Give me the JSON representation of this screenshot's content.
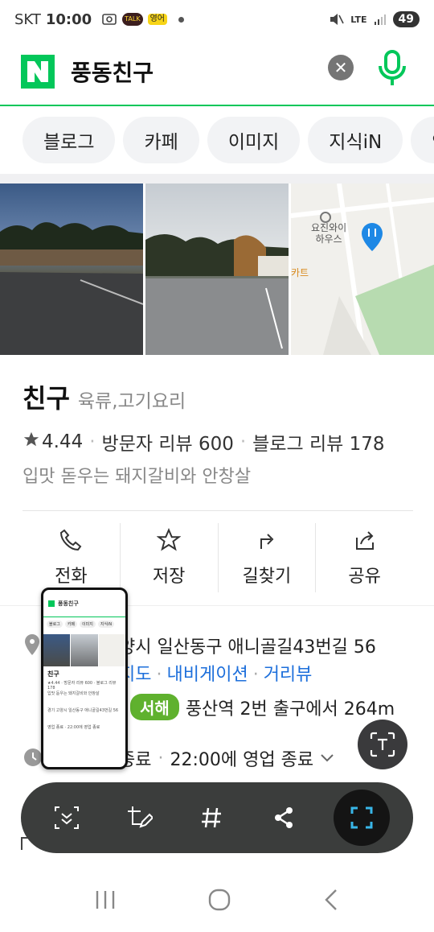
{
  "status_bar": {
    "carrier": "SKT",
    "time": "10:00",
    "talk_badge": "TALK",
    "yeongeo_badge": "영어",
    "lte": "LTE",
    "battery": "49"
  },
  "search": {
    "query": "풍동친구"
  },
  "tabs": [
    "블로그",
    "카페",
    "이미지",
    "지식iN",
    "인"
  ],
  "place": {
    "name": "친구",
    "category": "육류,고기요리",
    "rating": "4.44",
    "visitor_reviews": "방문자 리뷰 600",
    "blog_reviews": "블로그 리뷰 178",
    "description": "입맛 돋우는 돼지갈비와 안창살",
    "map_label": "요진와이\n하우스",
    "map_label_2": "카트"
  },
  "actions": {
    "call": "전화",
    "save": "저장",
    "directions": "길찾기",
    "share": "공유"
  },
  "info": {
    "address": "양시 일산동구 애니골길43번길 56",
    "link_map": "지도",
    "link_navi": "내비게이션",
    "link_distance": "거리뷰",
    "subway_line": "서해",
    "subway_text": "풍산역 2번 출구에서 264m",
    "hours_status": "종료",
    "hours_text": "22:00에 영업 종료"
  },
  "thumbnail": {
    "query": "풍동친구",
    "tabs": [
      "블로그",
      "카페",
      "이미지",
      "지식iN"
    ],
    "name": "친구",
    "rating_line": "★4.44 · 방문자 리뷰 600 · 블로그 리뷰 178",
    "desc": "입맛 돋우는 돼지갈비와 안창살",
    "addr_line": "경기 고양시 일산동구 애니골길43번길 56",
    "hours_line": "영업 종료 · 22:00에 영업 종료"
  },
  "colors": {
    "naver_green": "#03c75a",
    "link_blue": "#1d6fdb",
    "line_green": "#5fb12e",
    "toolbar_bg": "#3b3d3c"
  }
}
